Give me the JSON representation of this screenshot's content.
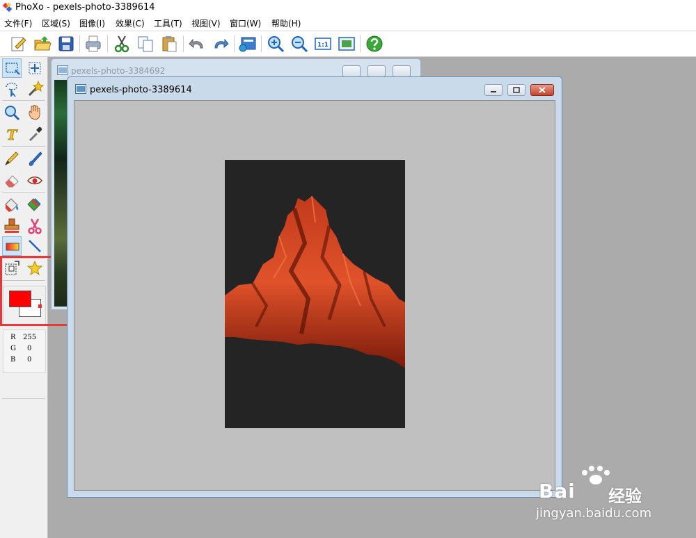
{
  "window": {
    "title": "PhoXo - pexels-photo-3389614"
  },
  "menu": [
    "文件(F)",
    "区域(S)",
    "图像(I)",
    "效果(C)",
    "工具(T)",
    "视图(V)",
    "窗口(W)",
    "帮助(H)"
  ],
  "toolbar": [
    "new-icon",
    "open-icon",
    "save-icon",
    "print-icon",
    "cut-icon",
    "copy-icon",
    "paste-icon",
    "undo-icon",
    "redo-icon",
    "scan-icon",
    "zoom-in-icon",
    "zoom-out-icon",
    "actual-size-icon",
    "fit-window-icon",
    "help-icon"
  ],
  "toolbar_actual_size_label": "1:1",
  "tools": [
    "rect-select",
    "move",
    "lasso-select",
    "magic-wand",
    "zoom",
    "hand",
    "text",
    "eyedropper",
    "pencil",
    "brush",
    "eraser",
    "red-eye",
    "fill",
    "color-replace",
    "stamp",
    "scissors",
    "gradient",
    "line",
    "transform",
    "star-shape"
  ],
  "colors": {
    "foreground": "#ff0000",
    "background": "#ffffff",
    "highlight": "#e5383b"
  },
  "rgb": {
    "r_label": "R",
    "r_value": "255",
    "g_label": "G",
    "g_value": "0",
    "b_label": "B",
    "b_value": "0"
  },
  "documents": {
    "back": {
      "title": "pexels-photo-3384692"
    },
    "front": {
      "title": "pexels-photo-3389614"
    }
  },
  "watermark": {
    "brand": "Bai",
    "brand_cn": "经验",
    "url": "jingyan.baidu.com"
  }
}
